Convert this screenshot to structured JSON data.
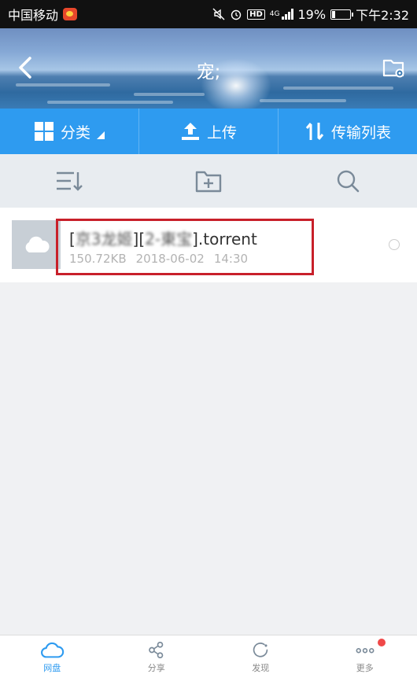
{
  "status_bar": {
    "carrier": "中国移动",
    "network": "4G",
    "battery_level": "19%",
    "battery_fraction": 0.19,
    "time": "下午2:32"
  },
  "header": {
    "title": "宠;"
  },
  "category_bar": {
    "items": [
      {
        "label": "分类",
        "icon": "grid-icon"
      },
      {
        "label": "上传",
        "icon": "upload-icon"
      },
      {
        "label": "传输列表",
        "icon": "transfer-icon"
      }
    ]
  },
  "toolbar": {
    "items": [
      {
        "icon": "sort-icon"
      },
      {
        "icon": "new-folder-icon"
      },
      {
        "icon": "search-icon"
      }
    ]
  },
  "files": [
    {
      "name_prefix": "[",
      "name_blurred_1": "京3龙姬",
      "name_mid": "][",
      "name_blurred_2": "2-東宝",
      "name_suffix": "].torrent",
      "size": "150.72KB",
      "date": "2018-06-02",
      "time": "14:30"
    }
  ],
  "bottom_nav": {
    "items": [
      {
        "label": "网盘",
        "icon": "cloud-icon",
        "active": true
      },
      {
        "label": "分享",
        "icon": "share-icon",
        "active": false
      },
      {
        "label": "发现",
        "icon": "discover-icon",
        "active": false
      },
      {
        "label": "更多",
        "icon": "more-icon",
        "active": false
      }
    ]
  },
  "colors": {
    "accent": "#2e9bf0",
    "highlight": "#c8202a",
    "badge": "#f04848"
  }
}
